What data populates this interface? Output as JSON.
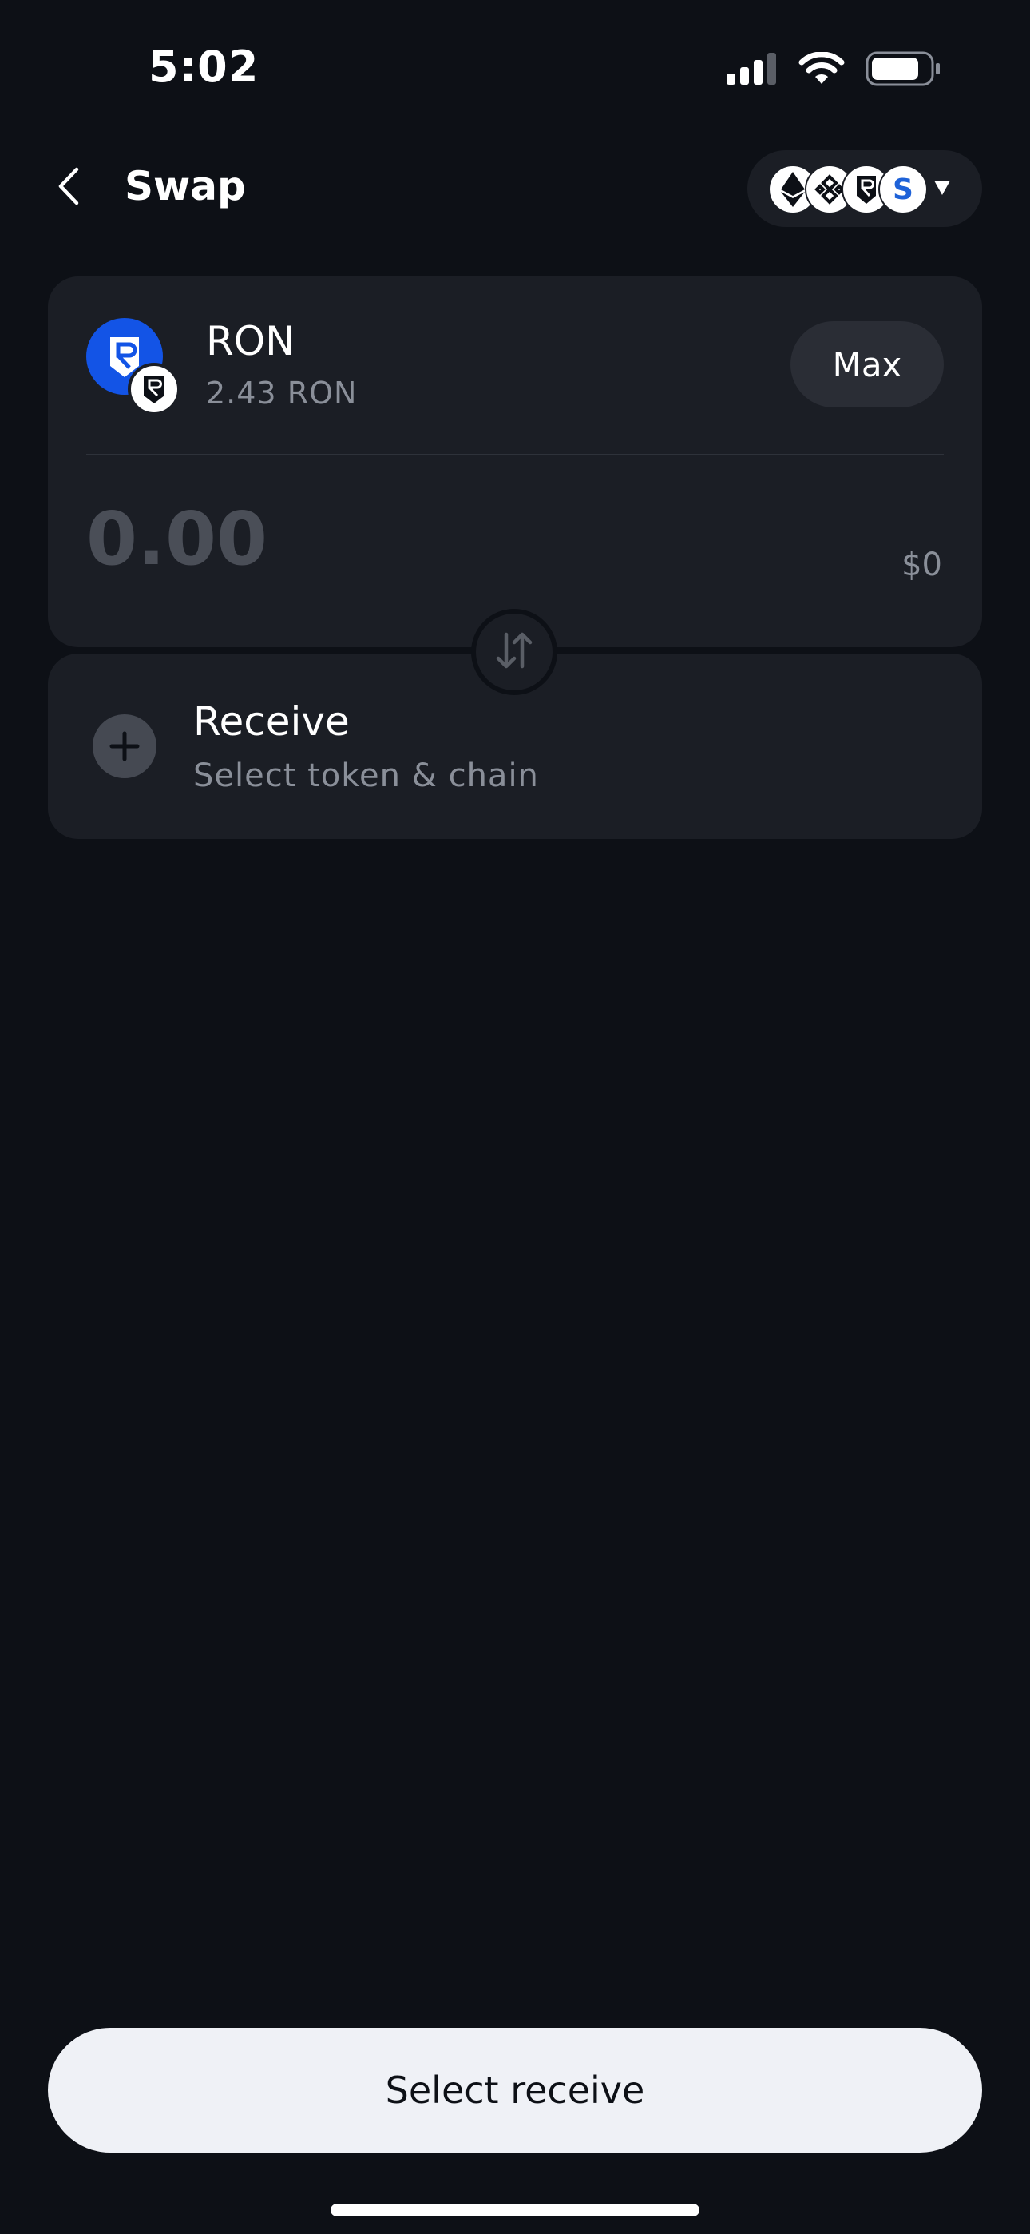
{
  "status_bar": {
    "time": "5:02",
    "icons": [
      "cellular-signal-icon",
      "wifi-icon",
      "battery-icon"
    ]
  },
  "header": {
    "title": "Swap",
    "back_icon": "chevron-left-icon",
    "networks": [
      "ethereum-icon",
      "bnb-chain-icon",
      "ronin-icon",
      "s-icon"
    ],
    "network_s_label": "S",
    "dropdown_icon": "chevron-down-icon"
  },
  "pay": {
    "token_symbol": "RON",
    "balance": "2.43 RON",
    "max_label": "Max",
    "amount_placeholder": "0.00",
    "fiat_value": "$0"
  },
  "receive": {
    "title": "Receive",
    "subtitle": "Select token & chain"
  },
  "footer": {
    "cta_label": "Select receive"
  },
  "colors": {
    "background": "#0d1016",
    "card": "#1b1e25",
    "ronin_blue": "#1354e6",
    "muted_text": "#8a8f99",
    "cta_background": "#eff1f6"
  }
}
